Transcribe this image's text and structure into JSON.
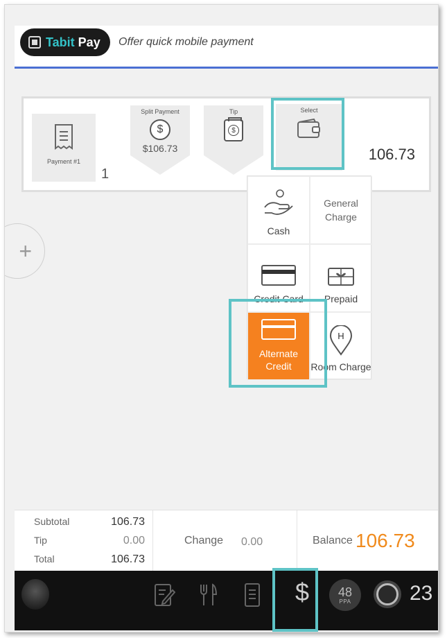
{
  "header": {
    "brand_tabit": "Tabit",
    "brand_pay": "Pay",
    "tagline": "Offer quick mobile payment"
  },
  "payment_row": {
    "payment_label": "Payment #1",
    "payment_number": "1",
    "split_label": "Split Payment",
    "split_value": "$106.73",
    "tip_label": "Tip",
    "select_label": "Select",
    "amount": "106.73"
  },
  "methods": [
    {
      "label": "Cash",
      "icon": "hand-coin-icon"
    },
    {
      "label": "General Charge",
      "icon": ""
    },
    {
      "label": "Credit Card",
      "icon": "credit-card-icon"
    },
    {
      "label": "Prepaid",
      "icon": "gift-card-icon"
    },
    {
      "label": "Alternate Credit",
      "icon": "card-icon",
      "active": true
    },
    {
      "label": "Room Charge",
      "icon": "hotel-pin-icon"
    }
  ],
  "totals": {
    "subtotal_label": "Subtotal",
    "subtotal_value": "106.73",
    "tip_label": "Tip",
    "tip_value": "0.00",
    "total_label": "Total",
    "total_value": "106.73",
    "change_label": "Change",
    "change_value": "0.00",
    "balance_label": "Balance",
    "balance_value": "106.73"
  },
  "bottombar": {
    "dollar": "$",
    "ppa_number": "48",
    "ppa_label": "PPA",
    "guests": "23"
  },
  "colors": {
    "accent_orange": "#f5811f",
    "highlight_teal": "#5ec3c6",
    "brand_teal": "#33c2c8",
    "header_line": "#4a6fd3"
  }
}
